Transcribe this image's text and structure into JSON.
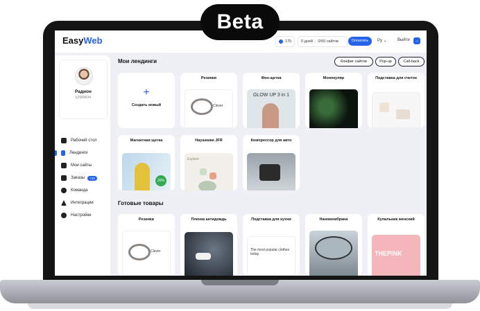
{
  "badge_label": "Beta",
  "topbar": {
    "logo_left": "Easy",
    "logo_right": "Web",
    "balance": "175",
    "days": "0 дней",
    "sites": "0/50 сайтов",
    "pay_label": "Оплатить",
    "lang": "Ру",
    "logout_label": "Выйти"
  },
  "profile": {
    "name": "Радион",
    "id": "k2989634"
  },
  "nav": [
    {
      "label": "Рабочий стол",
      "icon": "desktop-icon"
    },
    {
      "label": "Лендинги",
      "icon": "phone-icon",
      "active": true
    },
    {
      "label": "Мои сайты",
      "icon": "sites-icon"
    },
    {
      "label": "Заказы",
      "icon": "cart-icon",
      "badge": "+12"
    },
    {
      "label": "Команда",
      "icon": "team-icon"
    },
    {
      "label": "Интеграции",
      "icon": "rocket-icon"
    },
    {
      "label": "Настройки",
      "icon": "gear-icon"
    }
  ],
  "landings": {
    "title": "Мои лендинги",
    "actions": [
      "Конфиг сайтов",
      "Pop-up",
      "Call-back"
    ],
    "create_label": "Создать новый",
    "cards": [
      {
        "title": "Резинки",
        "thumb_caption": "Clever"
      },
      {
        "title": "Фен-щетка",
        "thumb_caption": "GLOW UP 3 in 1"
      },
      {
        "title": "Монокуляр"
      },
      {
        "title": "Подставка для счеток"
      },
      {
        "title": "Магнитная щетка",
        "thumb_caption": "20%"
      },
      {
        "title": "Наушники JFR",
        "thumb_caption": "Explore"
      },
      {
        "title": "Компрессор для авто"
      }
    ]
  },
  "products": {
    "title": "Готовые товары",
    "cards": [
      {
        "title": "Резинки",
        "thumb_caption": "Clever"
      },
      {
        "title": "Пленка антидождь"
      },
      {
        "title": "Подставка для кухни",
        "thumb_caption": "The most popular clothes today"
      },
      {
        "title": "Наномембрана"
      },
      {
        "title": "Купальник женский",
        "thumb_caption": "THEPINK"
      }
    ]
  },
  "colors": {
    "accent": "#2563eb",
    "bg": "#eef0f6"
  }
}
